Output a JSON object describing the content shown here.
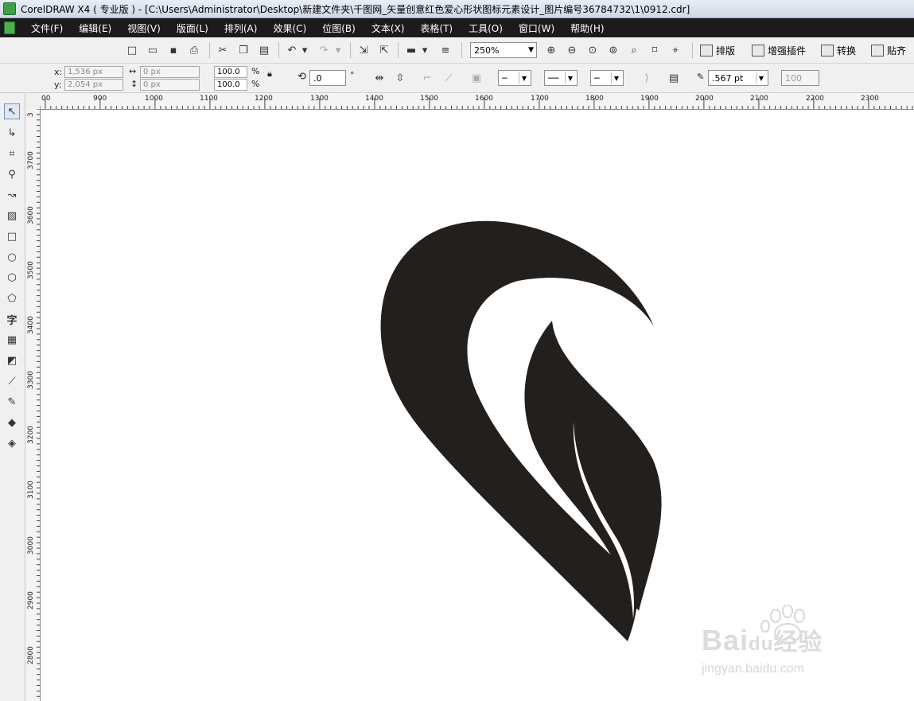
{
  "window": {
    "title": "CorelDRAW X4 ( 专业版 ) - [C:\\Users\\Administrator\\Desktop\\新建文件夹\\千图网_矢量创意红色爱心形状图标元素设计_图片编号36784732\\1\\0912.cdr]"
  },
  "menu": {
    "items": [
      "文件(F)",
      "编辑(E)",
      "视图(V)",
      "版面(L)",
      "排列(A)",
      "效果(C)",
      "位图(B)",
      "文本(X)",
      "表格(T)",
      "工具(O)",
      "窗口(W)",
      "帮助(H)"
    ]
  },
  "toolbar": {
    "zoom_value": "250%",
    "plugins": [
      "排版",
      "增强插件",
      "转换",
      "贴齐"
    ]
  },
  "property_bar": {
    "x_label": "x:",
    "y_label": "y:",
    "x_value": "1,536 px",
    "y_value": "2,054 px",
    "width_value": "0 px",
    "height_value": "0 px",
    "scale_x": "100.0",
    "scale_y": "100.0",
    "percent": "%",
    "rotation": ".0",
    "degree": "°",
    "outline_width": ".567 pt",
    "opacity_value": "100"
  },
  "rulers": {
    "horizontal_ticks": [
      "00",
      "900",
      "1000",
      "1100",
      "1200",
      "1300",
      "1400",
      "1500",
      "1600",
      "1700",
      "1800",
      "1900",
      "2000",
      "2100",
      "2200",
      "2300"
    ],
    "vertical_ticks": [
      "3",
      "3700",
      "3600",
      "3500",
      "3400",
      "3300",
      "3200",
      "3100",
      "3000",
      "2900",
      "2800"
    ]
  },
  "watermark": {
    "brand": "Bai",
    "brand_du": "du",
    "product": "经验",
    "url": "jingyan.baidu.com"
  },
  "colors": {
    "shape_fill": "#231f1c",
    "menubar_bg": "#1b1b1b"
  },
  "icons": [
    "app-icon",
    "new-document-icon",
    "open-icon",
    "save-icon",
    "print-icon",
    "cut-icon",
    "copy-icon",
    "paste-icon",
    "undo-icon",
    "redo-icon",
    "import-icon",
    "export-icon",
    "zoom-in-icon",
    "zoom-out-icon"
  ]
}
